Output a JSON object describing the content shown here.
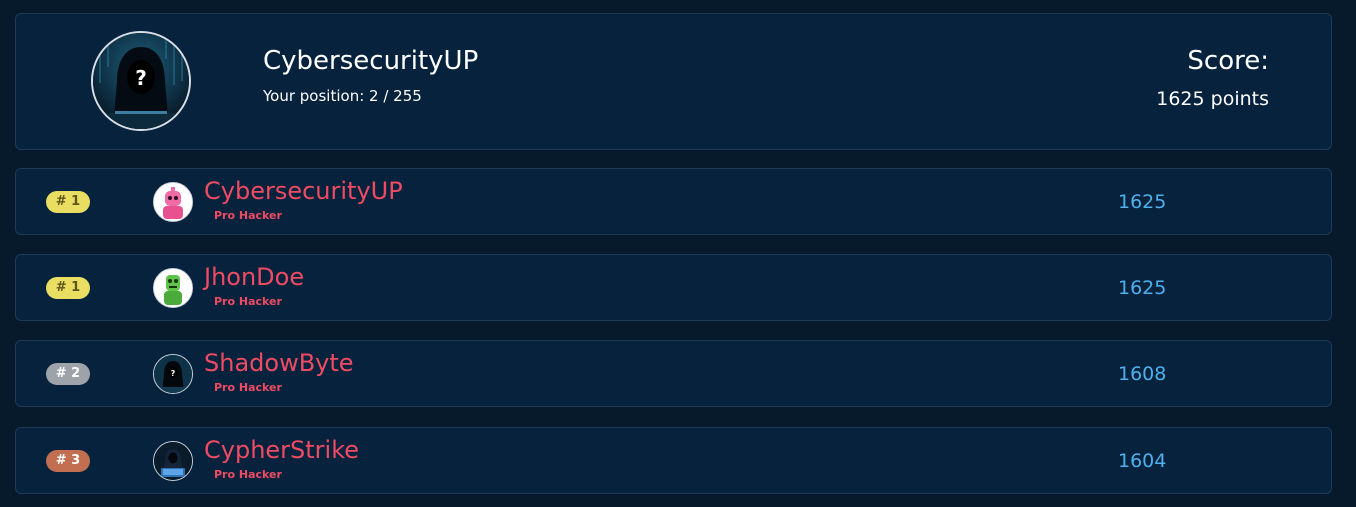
{
  "header": {
    "username": "CybersecurityUP",
    "position_text": "Your position: 2 / 255",
    "score_label": "Score:",
    "score_value": "1625 points",
    "avatar_icon": "hooded-hacker-avatar"
  },
  "leaderboard": [
    {
      "rank": "# 1",
      "rank_color": "#e9dd62",
      "rank_text_color": "#5d5618",
      "name": "CybersecurityUP",
      "title": "Pro Hacker",
      "score": "1625",
      "avatar_icon": "pink-robot-avatar"
    },
    {
      "rank": "# 1",
      "rank_color": "#e9dd62",
      "rank_text_color": "#5d5618",
      "name": "JhonDoe",
      "title": "Pro Hacker",
      "score": "1625",
      "avatar_icon": "green-robot-avatar"
    },
    {
      "rank": "# 2",
      "rank_color": "#9da3a9",
      "rank_text_color": "#ffffff",
      "name": "ShadowByte",
      "title": "Pro Hacker",
      "score": "1608",
      "avatar_icon": "hooded-hacker-avatar"
    },
    {
      "rank": "# 3",
      "rank_color": "#c16f50",
      "rank_text_color": "#ffffff",
      "name": "CypherStrike",
      "title": "Pro Hacker",
      "score": "1604",
      "avatar_icon": "hacker-laptop-avatar"
    }
  ],
  "colors": {
    "background": "#071a2c",
    "card": "#06223d",
    "name_accent": "#ef4b63",
    "score_accent": "#4fb0ee"
  }
}
